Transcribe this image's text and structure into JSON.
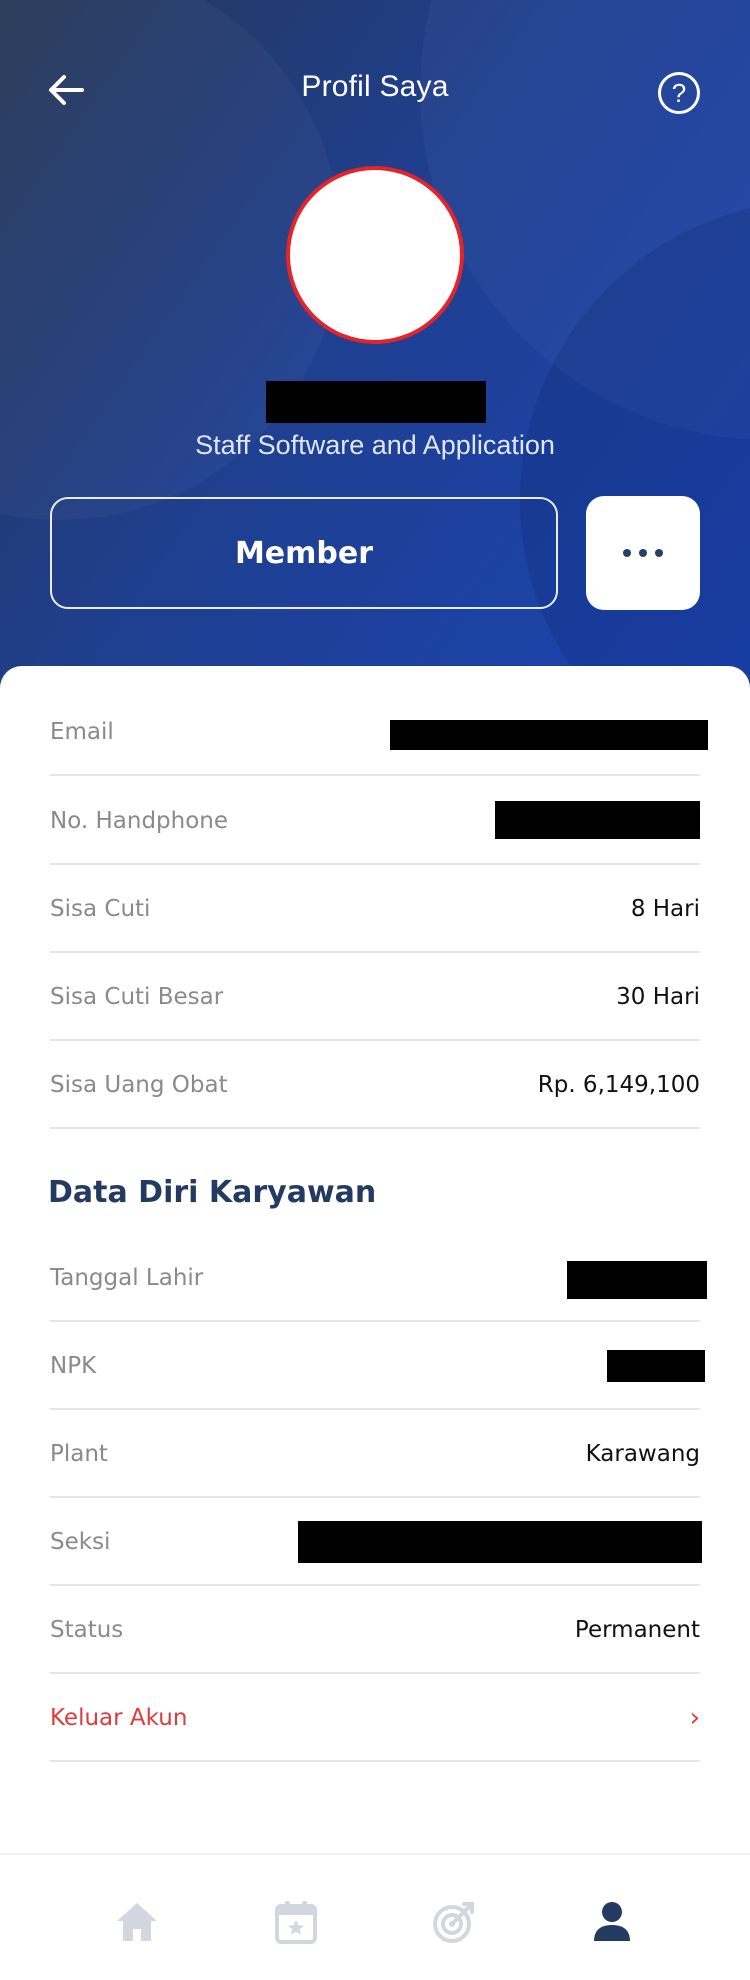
{
  "header": {
    "title": "Profil Saya",
    "back_icon": "arrow-left-icon",
    "help_icon": "help-circle-icon",
    "help_glyph": "?"
  },
  "profile": {
    "job_title": "Staff Software and Application",
    "member_label": "Member",
    "more_icon": "more-horizontal-icon"
  },
  "info_rows": [
    {
      "label": "Email",
      "value": ""
    },
    {
      "label": "No. Handphone",
      "value": ""
    },
    {
      "label": "Sisa Cuti",
      "value": "8 Hari"
    },
    {
      "label": "Sisa Cuti Besar",
      "value": "30 Hari"
    },
    {
      "label": "Sisa Uang Obat",
      "value": "Rp. 6,149,100"
    }
  ],
  "employee_section": {
    "title": "Data Diri Karyawan",
    "rows": [
      {
        "label": "Tanggal Lahir",
        "value": ""
      },
      {
        "label": "NPK",
        "value": ""
      },
      {
        "label": "Plant",
        "value": "Karawang"
      },
      {
        "label": "Seksi",
        "value": ""
      },
      {
        "label": "Status",
        "value": "Permanent"
      }
    ]
  },
  "logout": {
    "label": "Keluar Akun",
    "chevron": "›"
  },
  "bottom_nav": [
    {
      "icon": "home-icon",
      "active": false
    },
    {
      "icon": "calendar-star-icon",
      "active": false
    },
    {
      "icon": "target-icon",
      "active": false
    },
    {
      "icon": "user-icon",
      "active": true
    }
  ],
  "colors": {
    "header_gradient_start": "#263755",
    "header_gradient_end": "#1a44b4",
    "accent_red": "#e03b3b",
    "avatar_border": "#e5232b",
    "section_title": "#253a60",
    "nav_active": "#253a60",
    "nav_inactive": "#d3d6de"
  }
}
